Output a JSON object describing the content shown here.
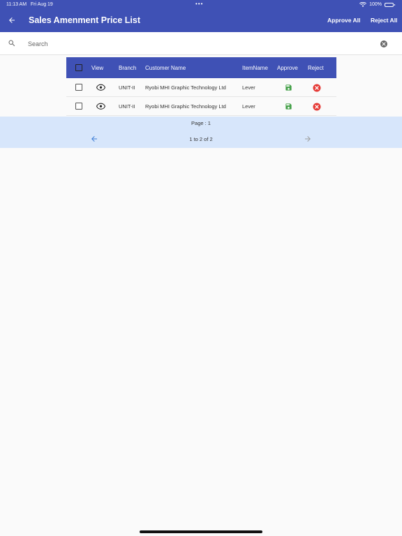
{
  "status_bar": {
    "time": "11:13 AM",
    "date": "Fri Aug 19",
    "dots": "•••",
    "battery": "100%"
  },
  "header": {
    "title": "Sales Amenment Price List",
    "approve_all": "Approve All",
    "reject_all": "Reject All"
  },
  "search": {
    "placeholder": "Search",
    "value": ""
  },
  "table": {
    "columns": {
      "view": "View",
      "branch": "Branch",
      "customer": "Customer Name",
      "item": "ItemName",
      "approve": "Approve",
      "reject": "Reject"
    },
    "rows": [
      {
        "branch": "UNIT-II",
        "customer": "Ryobi MHI Graphic Technology Ltd",
        "item": "Lever"
      },
      {
        "branch": "UNIT-II",
        "customer": "Ryobi MHI Graphic Technology Ltd",
        "item": "Lever"
      }
    ]
  },
  "pagination": {
    "page_label": "Page : 1",
    "range_label": "1 to 2 of 2"
  },
  "colors": {
    "primary": "#3f51b5",
    "approve": "#43a047",
    "reject": "#e53935",
    "pager_bg": "#d7e6fb"
  }
}
